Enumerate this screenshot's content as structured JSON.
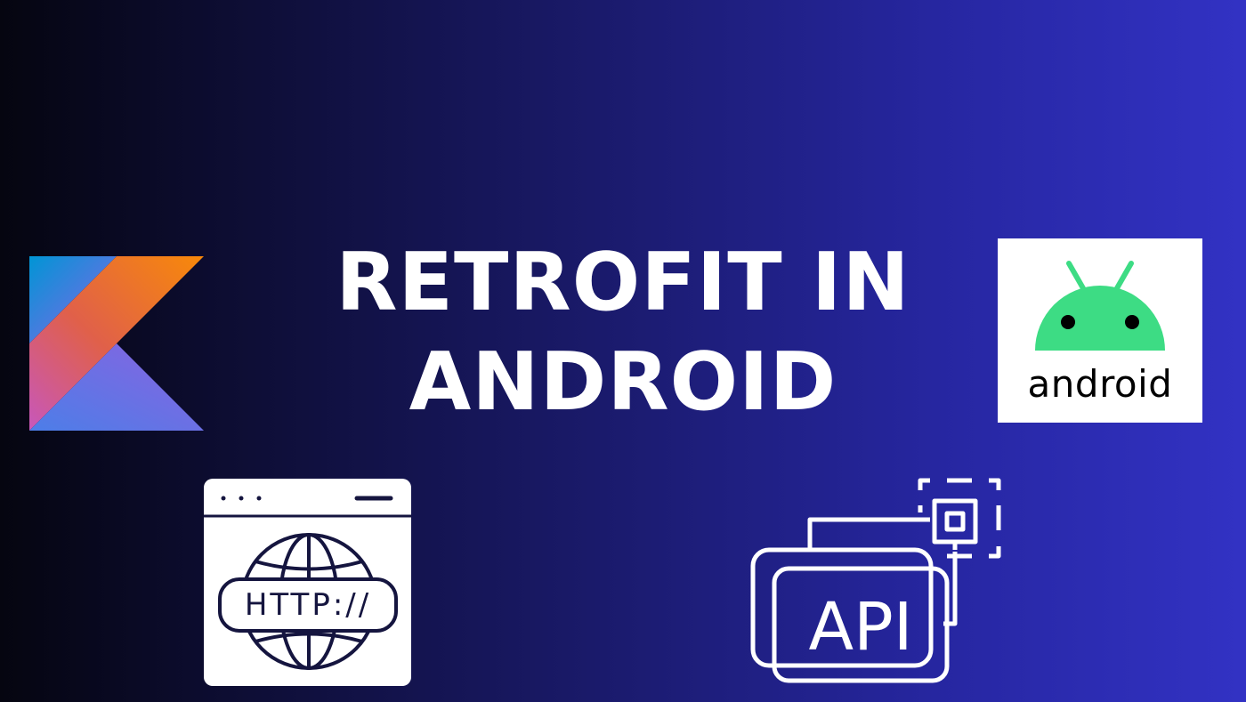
{
  "title": {
    "line1": "RETROFIT IN",
    "line2": "ANDROID"
  },
  "logos": {
    "kotlin": "kotlin-logo",
    "android_wordmark": "android",
    "android_robot_color": "#3ddc84"
  },
  "icons": {
    "http": "http-globe-window-icon",
    "http_text": "HTTP://",
    "api": "api-cards-icon",
    "api_text": "API"
  },
  "colors": {
    "background_start": "#050510",
    "background_end": "#3232c4",
    "title": "#ffffff"
  }
}
